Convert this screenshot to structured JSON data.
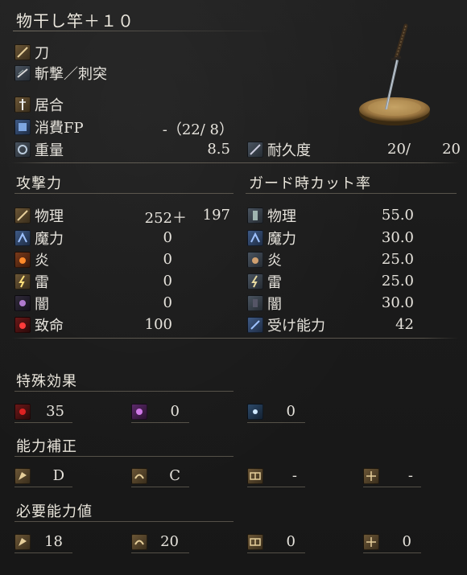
{
  "weapon": {
    "name": "物干し竿＋１０",
    "type": "刀",
    "attack_type": "斬撃／刺突",
    "skill": "居合",
    "fp_cost_label": "消費FP",
    "fp_cost_value": "-（22/  8）",
    "weight_label": "重量",
    "weight_value": "8.5",
    "durability_label": "耐久度",
    "durability_current": "20/",
    "durability_max": "20"
  },
  "attack": {
    "title": "攻撃力",
    "rows": [
      {
        "label": "物理",
        "value": "252＋",
        "bonus": "197",
        "icon": "physical-icon"
      },
      {
        "label": "魔力",
        "value": "0",
        "icon": "magic-icon"
      },
      {
        "label": "炎",
        "value": "0",
        "icon": "fire-icon"
      },
      {
        "label": "雷",
        "value": "0",
        "icon": "lightning-icon"
      },
      {
        "label": "闇",
        "value": "0",
        "icon": "dark-icon"
      },
      {
        "label": "致命",
        "value": "100",
        "icon": "critical-icon"
      }
    ]
  },
  "guard": {
    "title": "ガード時カット率",
    "rows": [
      {
        "label": "物理",
        "value": "55.0",
        "icon": "physical-guard-icon"
      },
      {
        "label": "魔力",
        "value": "30.0",
        "icon": "magic-guard-icon"
      },
      {
        "label": "炎",
        "value": "25.0",
        "icon": "fire-guard-icon"
      },
      {
        "label": "雷",
        "value": "25.0",
        "icon": "lightning-guard-icon"
      },
      {
        "label": "闇",
        "value": "30.0",
        "icon": "dark-guard-icon"
      },
      {
        "label": "受け能力",
        "value": "42",
        "icon": "stability-icon"
      }
    ]
  },
  "special": {
    "title": "特殊効果",
    "items": [
      {
        "icon": "bleed-icon",
        "value": "35"
      },
      {
        "icon": "poison-icon",
        "value": "0"
      },
      {
        "icon": "frost-icon",
        "value": "0"
      }
    ]
  },
  "scaling": {
    "title": "能力補正",
    "items": [
      {
        "icon": "strength-icon",
        "value": "D"
      },
      {
        "icon": "dexterity-icon",
        "value": "C"
      },
      {
        "icon": "intelligence-icon",
        "value": "-"
      },
      {
        "icon": "faith-icon",
        "value": "-"
      }
    ]
  },
  "requirements": {
    "title": "必要能力値",
    "items": [
      {
        "icon": "strength-icon",
        "value": "18"
      },
      {
        "icon": "dexterity-icon",
        "value": "20"
      },
      {
        "icon": "intelligence-icon",
        "value": "0"
      },
      {
        "icon": "faith-icon",
        "value": "0"
      }
    ]
  }
}
